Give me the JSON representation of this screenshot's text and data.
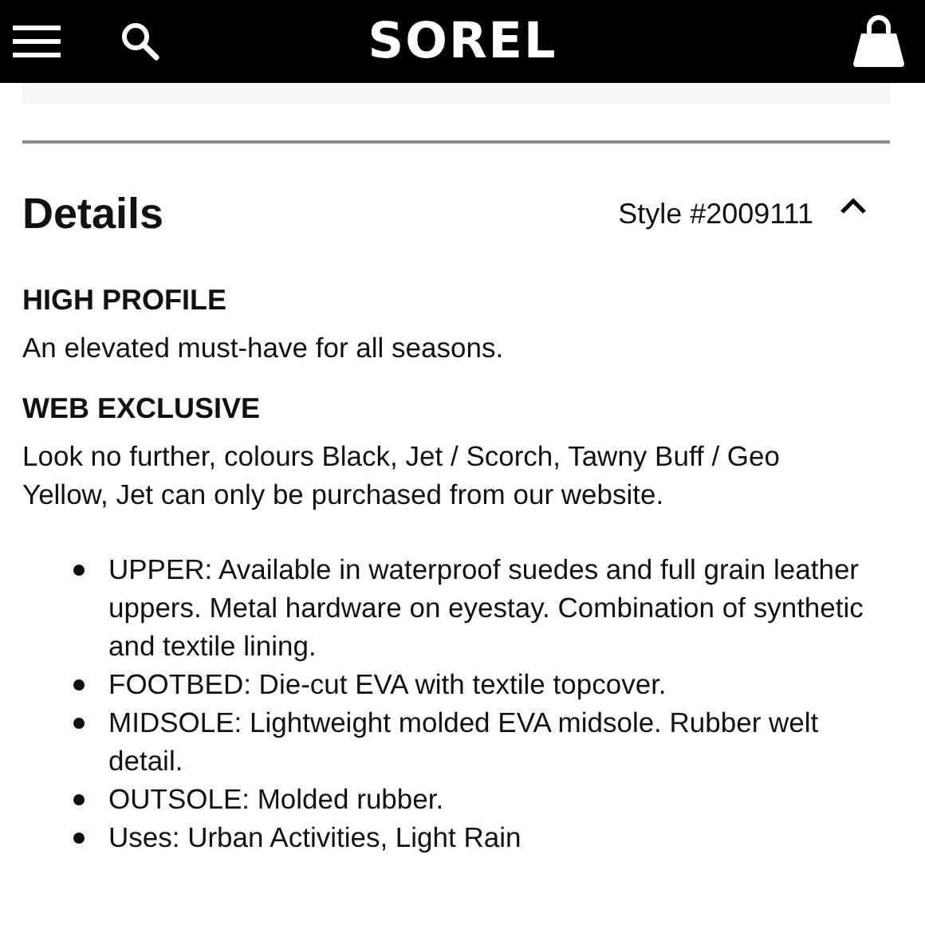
{
  "header": {
    "logo": "SOREL"
  },
  "details": {
    "title": "Details",
    "style": "Style #2009111",
    "expanded": true
  },
  "sections": [
    {
      "heading": "HIGH PROFILE",
      "text": "An elevated must-have for all seasons."
    },
    {
      "heading": "WEB EXCLUSIVE",
      "text": "Look no further, colours Black, Jet / Scorch, Tawny Buff / Geo Yellow, Jet can only be purchased from our website."
    }
  ],
  "features": [
    "UPPER: Available in waterproof suedes and full grain leather uppers. Metal hardware on eyestay. Combination of synthetic and textile lining.",
    "FOOTBED: Die-cut EVA with textile topcover.",
    "MIDSOLE: Lightweight molded EVA midsole. Rubber welt detail.",
    "OUTSOLE: Molded rubber.",
    "Uses: Urban Activities, Light Rain"
  ]
}
